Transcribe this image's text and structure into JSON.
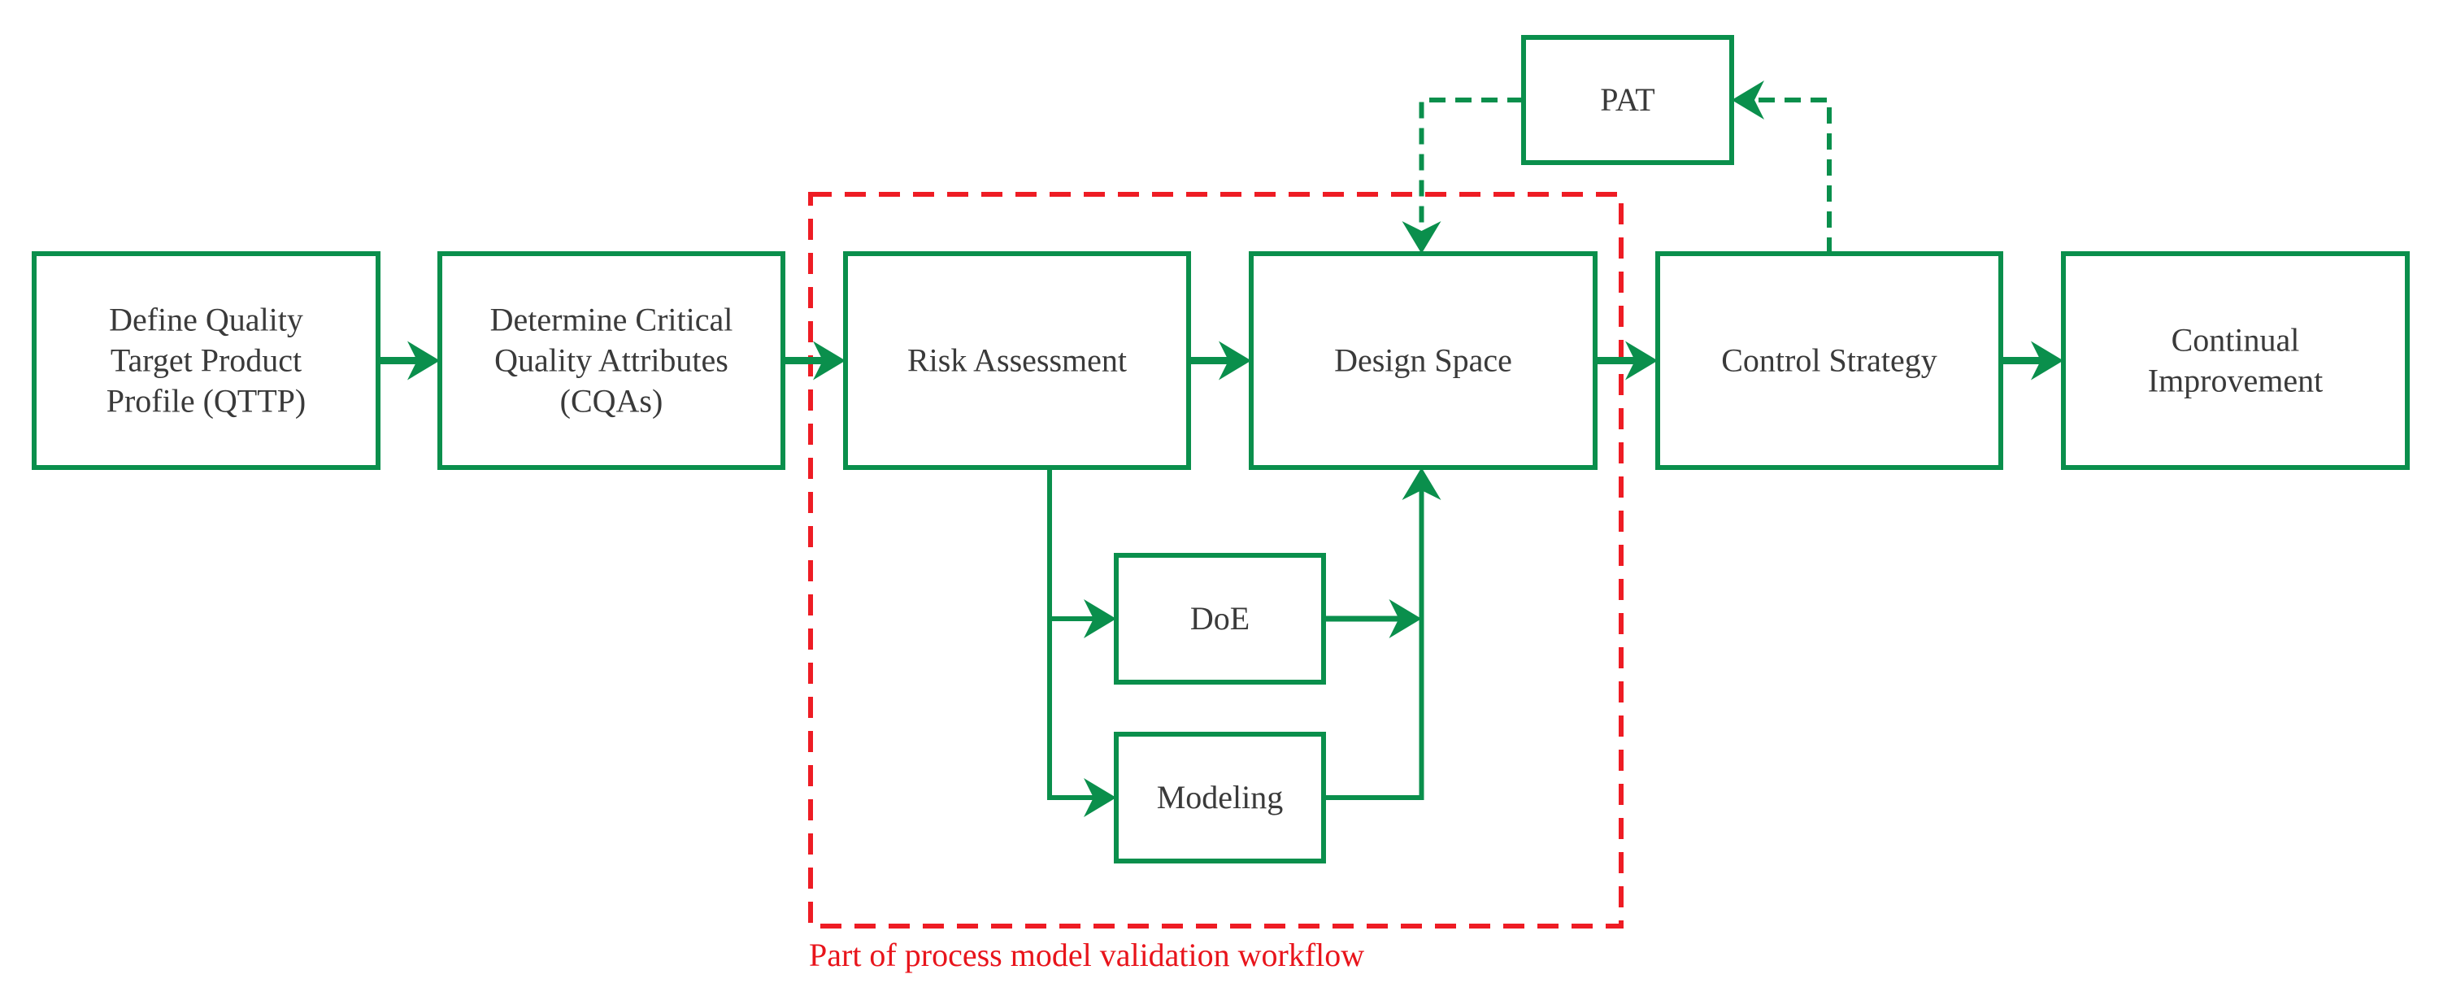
{
  "colors": {
    "box_stroke": "#0a8f4c",
    "arrow": "#0a8f4c",
    "region_stroke": "#ee1c24",
    "region_caption": "#e8141b",
    "text": "#3a3a3a",
    "background": "#ffffff"
  },
  "nodes": {
    "qttp": {
      "lines": [
        "Define Quality",
        "Target Product",
        "Profile (QTTP)"
      ]
    },
    "cqas": {
      "lines": [
        "Determine Critical",
        "Quality Attributes",
        "(CQAs)"
      ]
    },
    "risk": {
      "lines": [
        "Risk Assessment"
      ]
    },
    "design": {
      "lines": [
        "Design Space"
      ]
    },
    "control": {
      "lines": [
        "Control Strategy"
      ]
    },
    "continual": {
      "lines": [
        "Continual",
        "Improvement"
      ]
    },
    "pat": {
      "lines": [
        "PAT"
      ]
    },
    "doe": {
      "lines": [
        "DoE"
      ]
    },
    "modeling": {
      "lines": [
        "Modeling"
      ]
    }
  },
  "edges": [
    {
      "from": "qttp",
      "to": "cqas",
      "style": "solid"
    },
    {
      "from": "cqas",
      "to": "risk",
      "style": "solid"
    },
    {
      "from": "risk",
      "to": "design",
      "style": "solid"
    },
    {
      "from": "design",
      "to": "control",
      "style": "solid"
    },
    {
      "from": "control",
      "to": "continual",
      "style": "solid"
    },
    {
      "from": "risk",
      "to": "doe",
      "style": "solid"
    },
    {
      "from": "risk",
      "to": "modeling",
      "style": "solid"
    },
    {
      "from": "doe",
      "to": "design",
      "style": "solid"
    },
    {
      "from": "modeling",
      "to": "design",
      "style": "solid"
    },
    {
      "from": "control",
      "to": "pat",
      "style": "dashed"
    },
    {
      "from": "pat",
      "to": "design",
      "style": "dashed"
    }
  ],
  "region": {
    "caption": "Part of process model validation workflow",
    "members": [
      "risk",
      "design",
      "doe",
      "modeling"
    ]
  }
}
